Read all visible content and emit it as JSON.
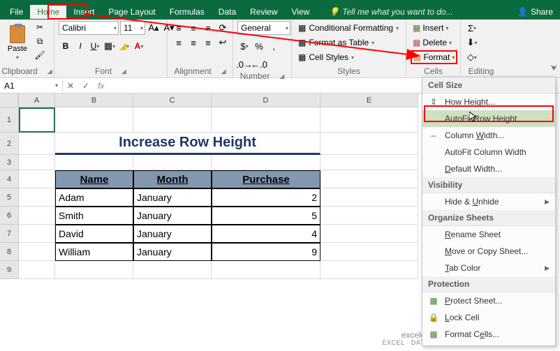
{
  "tabs": {
    "file": "File",
    "home": "Home",
    "insert": "Insert",
    "pagelayout": "Page Layout",
    "formulas": "Formulas",
    "data": "Data",
    "review": "Review",
    "view": "View",
    "tellme": "Tell me what you want to do...",
    "share": "Share"
  },
  "ribbon": {
    "clipboard": {
      "paste": "Paste",
      "label": "Clipboard"
    },
    "font": {
      "name": "Calibri",
      "size": "11",
      "label": "Font"
    },
    "alignment": {
      "label": "Alignment"
    },
    "number": {
      "format": "General",
      "label": "Number"
    },
    "styles": {
      "conditional": "Conditional Formatting",
      "table": "Format as Table",
      "cell": "Cell Styles",
      "label": "Styles"
    },
    "cells": {
      "insert": "Insert",
      "delete": "Delete",
      "format": "Format",
      "label": "Cells"
    },
    "editing": {
      "label": "Editing"
    }
  },
  "namebox": "A1",
  "columns": [
    "A",
    "B",
    "C",
    "D",
    "E"
  ],
  "rows": [
    "1",
    "2",
    "3",
    "4",
    "5",
    "6",
    "7",
    "8",
    "9"
  ],
  "sheet_title": "Increase Row Height",
  "table": {
    "headers": [
      "Name",
      "Month",
      "Purchase"
    ],
    "rows": [
      {
        "name": "Adam",
        "month": "January",
        "purchase": "2"
      },
      {
        "name": "Smith",
        "month": "January",
        "purchase": "5"
      },
      {
        "name": "David",
        "month": "January",
        "purchase": "4"
      },
      {
        "name": "William",
        "month": "January",
        "purchase": "9"
      }
    ]
  },
  "menu": {
    "cellsize": "Cell Size",
    "rowheight": "Row Height...",
    "autofitrow": "AutoFit Row Height",
    "colwidth": "Column Width...",
    "autofitcol": "AutoFit Column Width",
    "defwidth": "Default Width...",
    "visibility": "Visibility",
    "hide": "Hide & Unhide",
    "organize": "Organize Sheets",
    "rename": "Rename Sheet",
    "move": "Move or Copy Sheet...",
    "tabcolor": "Tab Color",
    "protection": "Protection",
    "protect": "Protect Sheet...",
    "lock": "Lock Cell",
    "formatcells": "Format Cells..."
  },
  "watermark": {
    "main": "exceldemy",
    "sub": "EXCEL · DATA · BI"
  },
  "chart_data": null
}
